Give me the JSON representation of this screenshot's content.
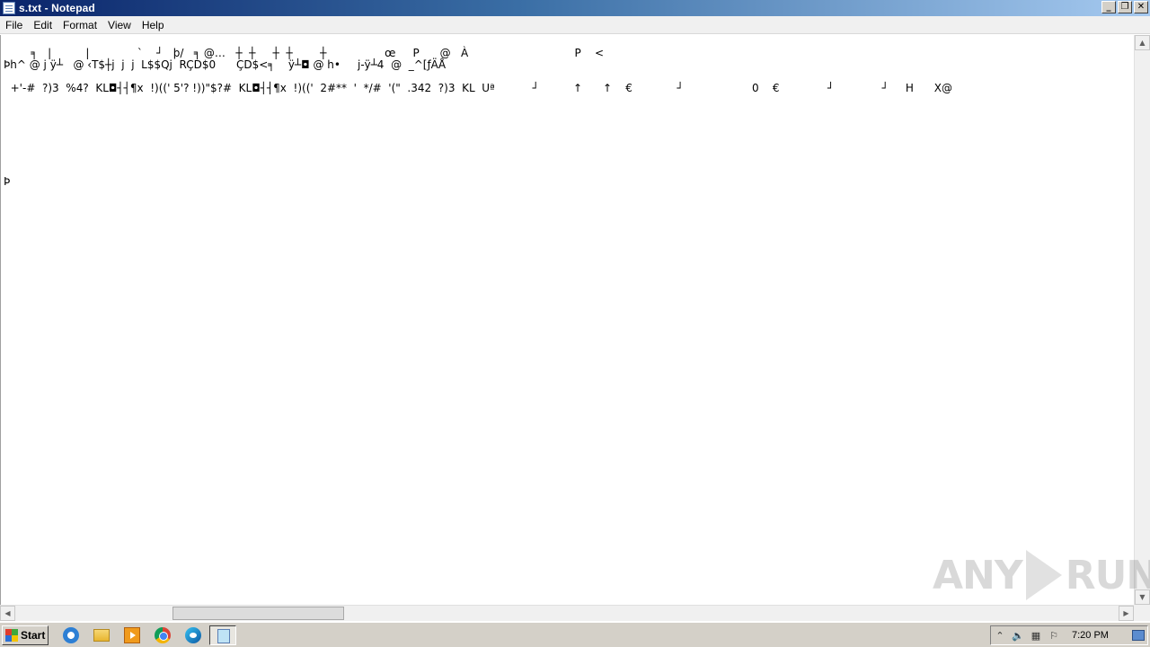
{
  "window": {
    "title": "s.txt - Notepad",
    "buttons": {
      "minimize": "_",
      "restore": "❐",
      "close": "✕"
    }
  },
  "menu": {
    "items": [
      "File",
      "Edit",
      "Format",
      "View",
      "Help"
    ]
  },
  "editor": {
    "lines": [
      "        ╕   |          |              `    ┘   þ/   ╕ @…   ┼  ┼     ┼  ┼        ┼                 œ     P      @   À                               P    <",
      "Þh^ @ j ÿ┴   @ ‹T$┼j  j  j  L$$Qj  RÇD$0      ÇD$<╕    ÿ┴◘ @ h•     j-ÿ┴4  @  _^[ƒÄÅ",
      "  +'-#  ?)3  %4?  KL◘┤┤¶x  !)((' 5'? !))\"$?#  KL◘┤┤¶x  !)(('  2#**  '  */#  '(\"  .342  ?)3  KL  Uª           ┘          ↑      ↑    €             ┘                    0    €              ┘              ┘     H      X@",
      "Þ"
    ]
  },
  "taskbar": {
    "start_label": "Start",
    "clock": "7:20 PM",
    "tray_icons": [
      "chevron-up-icon",
      "speaker-icon",
      "network-icon",
      "flag-icon"
    ]
  },
  "watermark": {
    "left": "ANY",
    "right": "RUN"
  }
}
